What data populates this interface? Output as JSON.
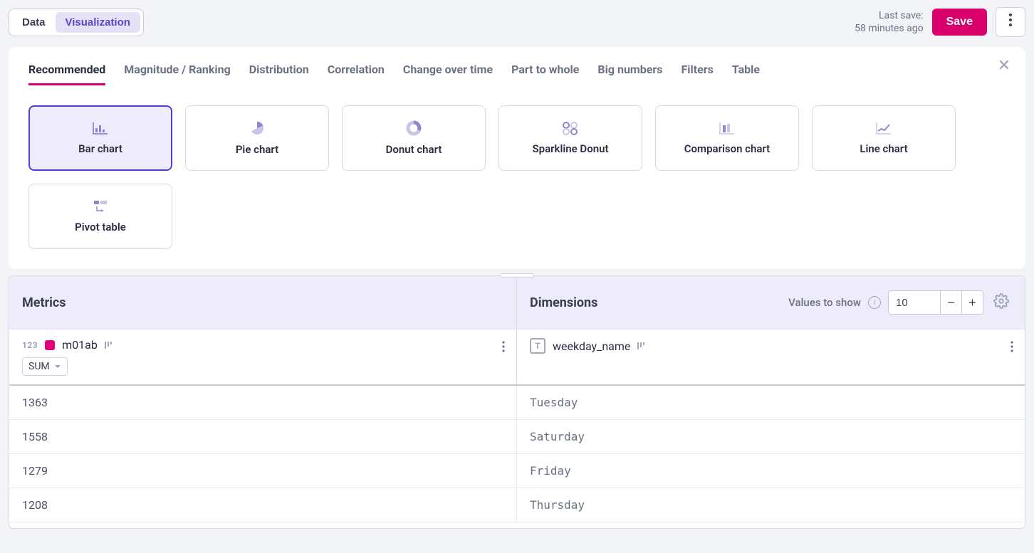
{
  "topbar": {
    "segment_data": "Data",
    "segment_viz": "Visualization",
    "last_save_label": "Last save:",
    "last_save_value": "58 minutes ago",
    "save_label": "Save"
  },
  "tabs": [
    "Recommended",
    "Magnitude / Ranking",
    "Distribution",
    "Correlation",
    "Change over time",
    "Part to whole",
    "Big numbers",
    "Filters",
    "Table"
  ],
  "chart_cards": [
    "Bar chart",
    "Pie chart",
    "Donut chart",
    "Sparkline Donut",
    "Comparison chart",
    "Line chart",
    "Pivot table"
  ],
  "columns": {
    "metrics_header": "Metrics",
    "dimensions_header": "Dimensions",
    "values_to_show_label": "Values to show",
    "values_to_show_value": "10",
    "metric_type_badge": "123",
    "metric_name": "m01ab",
    "metric_agg": "SUM",
    "dimension_type_badge": "T",
    "dimension_name": "weekday_name"
  },
  "rows": [
    {
      "metric": "1363",
      "dimension": "Tuesday"
    },
    {
      "metric": "1558",
      "dimension": "Saturday"
    },
    {
      "metric": "1279",
      "dimension": "Friday"
    },
    {
      "metric": "1208",
      "dimension": "Thursday"
    }
  ]
}
